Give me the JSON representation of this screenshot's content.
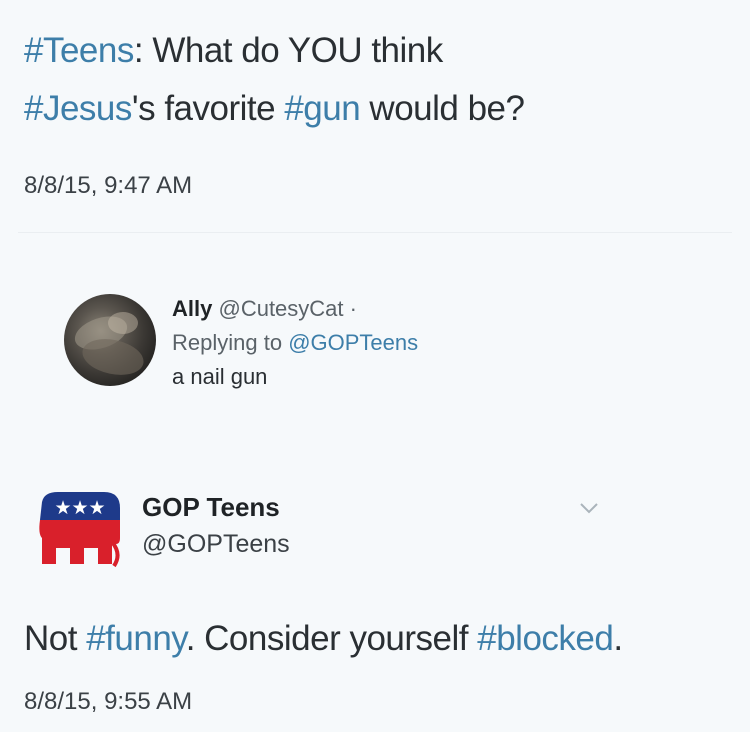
{
  "top_tweet": {
    "line1_hashtag": "#Teens",
    "line1_text": ": What do YOU think",
    "line2_hashtag1": "#Jesus",
    "line2_mid": "'s favorite ",
    "line2_hashtag2": "#gun",
    "line2_end": " would be?",
    "timestamp": "8/8/15, 9:47 AM"
  },
  "reply": {
    "name": "Ally",
    "handle": "@CutesyCat",
    "separator": "·",
    "replying_prefix": "Replying to ",
    "replying_to": "@GOPTeens",
    "text": "a nail gun"
  },
  "gop": {
    "name": "GOP Teens",
    "handle": "@GOPTeens",
    "logo_stars": "★★★",
    "tweet_start": "Not ",
    "tweet_hashtag1": "#funny",
    "tweet_mid": ". Consider yourself  ",
    "tweet_hashtag2": "#blocked",
    "tweet_end": ".",
    "timestamp": "8/8/15, 9:55 AM"
  },
  "colors": {
    "hashtag": "#3d7ea9",
    "background": "#f6f9fb",
    "logo_blue": "#1e3a8a",
    "logo_red": "#d9202b"
  }
}
